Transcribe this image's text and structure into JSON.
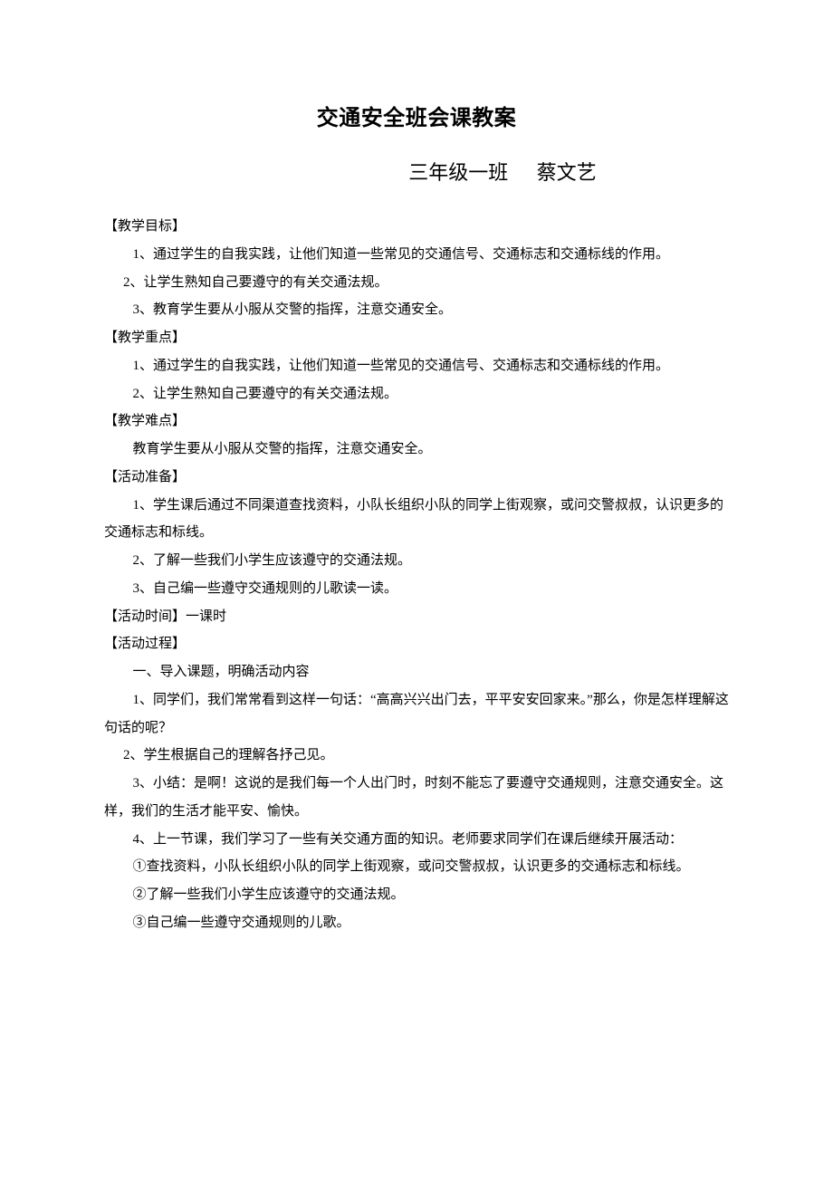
{
  "title": "交通安全班会课教案",
  "subtitle": {
    "left": "三年级一班",
    "right": "蔡文艺"
  },
  "body": {
    "s1_h": "【教学目标】",
    "s1_p1": "1、通过学生的自我实践，让他们知道一些常见的交通信号、交通标志和交通标线的作用。",
    "s1_p2": "2、让学生熟知自己要遵守的有关交通法规。",
    "s1_p3": "3、教育学生要从小服从交警的指挥，注意交通安全。",
    "s2_h": "【教学重点】",
    "s2_p1": "1、通过学生的自我实践，让他们知道一些常见的交通信号、交通标志和交通标线的作用。",
    "s2_p2": "2、让学生熟知自己要遵守的有关交通法规。",
    "s3_h": "【教学难点】",
    "s3_p1": "教育学生要从小服从交警的指挥，注意交通安全。",
    "s4_h": "【活动准备】",
    "s4_p1": "1、学生课后通过不同渠道查找资料，小队长组织小队的同学上街观察，或问交警叔叔，认识更多的交通标志和标线。",
    "s4_p2": "2、了解一些我们小学生应该遵守的交通法规。",
    "s4_p3": "3、自己编一些遵守交通规则的儿歌读一读。",
    "s5_h": "【活动时间】一课时",
    "s6_h": "【活动过程】",
    "s6_p1": "一、导入课题，明确活动内容",
    "s6_p2": "1、同学们，我们常常看到这样一句话：“高高兴兴出门去，平平安安回家来。”那么，你是怎样理解这句话的呢？",
    "s6_p3": "2、学生根据自己的理解各抒己见。",
    "s6_p4": "3、小结：是啊！这说的是我们每一个人出门时，时刻不能忘了要遵守交通规则，注意交通安全。这样，我们的生活才能平安、愉快。",
    "s6_p5": "4、上一节课，我们学习了一些有关交通方面的知识。老师要求同学们在课后继续开展活动：",
    "s6_p6": "①查找资料，小队长组织小队的同学上街观察，或问交警叔叔，认识更多的交通标志和标线。",
    "s6_p7": "②了解一些我们小学生应该遵守的交通法规。",
    "s6_p8": "③自己编一些遵守交通规则的儿歌。"
  }
}
